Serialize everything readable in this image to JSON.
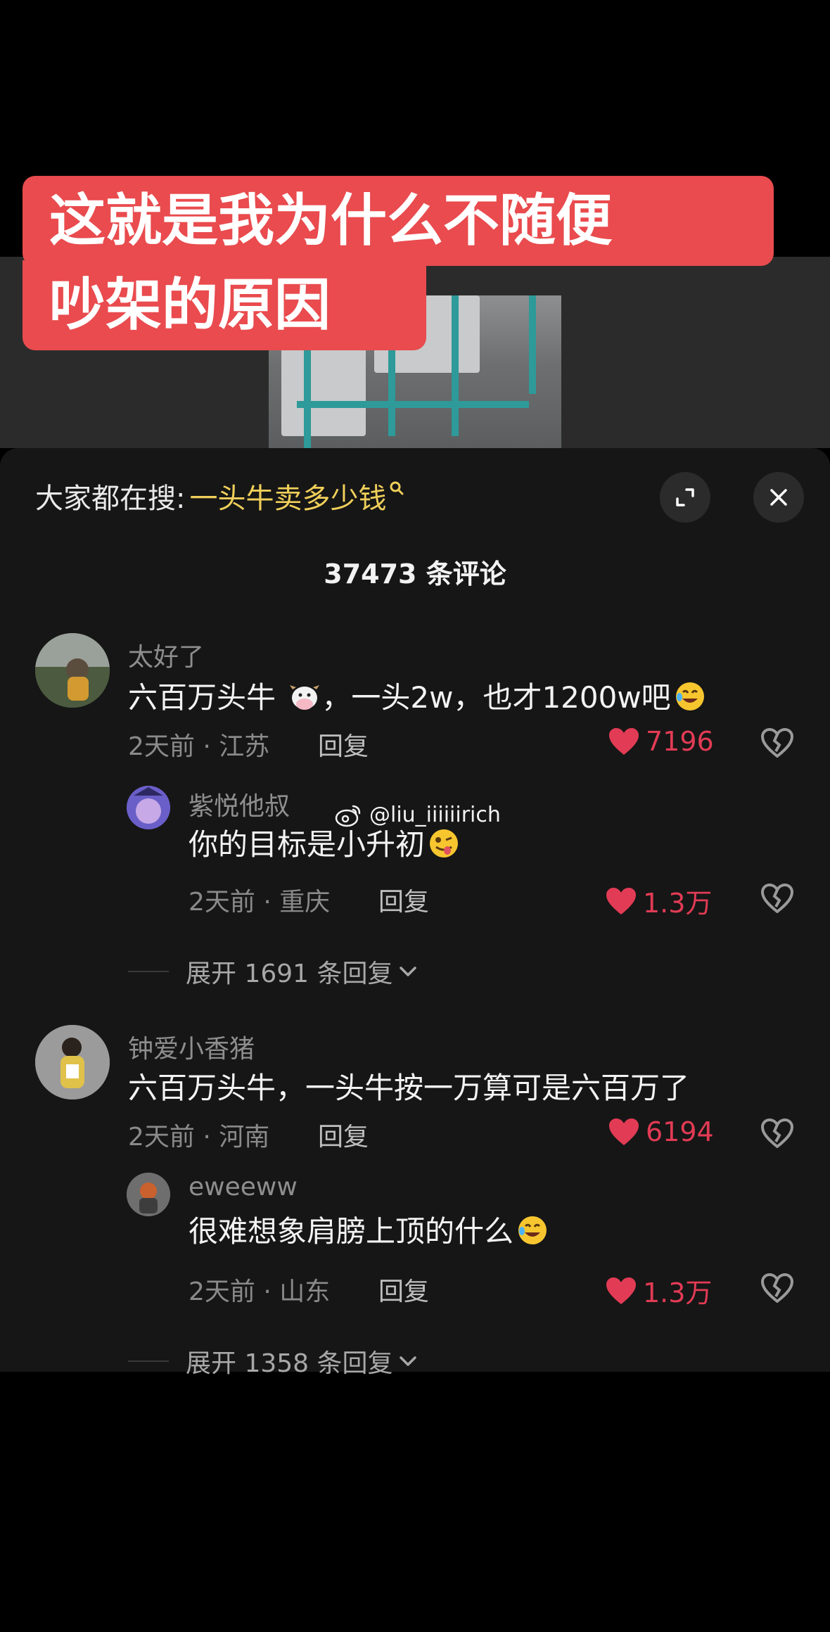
{
  "caption": {
    "line1": "这就是我为什么不随便",
    "line2": "吵架的原因"
  },
  "header": {
    "search_prefix": "大家都在搜:",
    "search_term": "一头牛卖多少钱",
    "comment_count": "37473 条评论"
  },
  "comments": [
    {
      "name": "太好了",
      "text": "六百万头牛",
      "text_rest": "，一头2w，也才1200w吧",
      "meta": "2天前 · 江苏",
      "reply_label": "回复",
      "likes": "7196"
    },
    {
      "name": "紫悦他叔",
      "text": "你的目标是小升初",
      "meta": "2天前 · 重庆",
      "reply_label": "回复",
      "likes": "1.3万"
    },
    {
      "name": "钟爱小香猪",
      "text": "六百万头牛，一头牛按一万算可是六百万了",
      "meta": "2天前 · 河南",
      "reply_label": "回复",
      "likes": "6194"
    },
    {
      "name": "eweeww",
      "text": "很难想象肩膀上顶的什么",
      "meta": "2天前 · 山东",
      "reply_label": "回复",
      "likes": "1.3万"
    }
  ],
  "expand": [
    {
      "label": "展开 1691 条回复"
    },
    {
      "label": "展开 1358 条回复"
    }
  ],
  "watermark": "@liu_iiiiiirich",
  "icons": {
    "expand": "expand-icon",
    "close": "close-icon",
    "like": "heart-icon",
    "dislike": "broken-heart-icon",
    "weibo": "weibo-icon"
  },
  "colors": {
    "caption_bg": "#e94b4e",
    "search_term": "#f0cf5a",
    "like": "#e23b55",
    "sheet_bg": "#161616"
  }
}
